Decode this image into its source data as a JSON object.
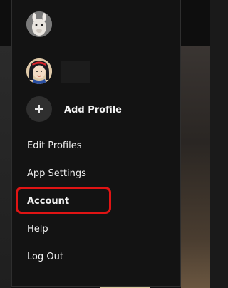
{
  "profile_menu": {
    "current_profile_avatar": "llama-avatar-icon",
    "profiles": [
      {
        "avatar": "snow-white-avatar-icon",
        "name": ""
      }
    ],
    "add_profile_label": "Add Profile",
    "add_icon": "plus-icon",
    "items": [
      {
        "label": "Edit Profiles"
      },
      {
        "label": "App Settings"
      },
      {
        "label": "Account",
        "highlighted": true
      },
      {
        "label": "Help"
      },
      {
        "label": "Log Out"
      }
    ]
  },
  "colors": {
    "menu_background": "#131313",
    "text": "#f2f2f2",
    "highlight_ring": "#e01414"
  }
}
